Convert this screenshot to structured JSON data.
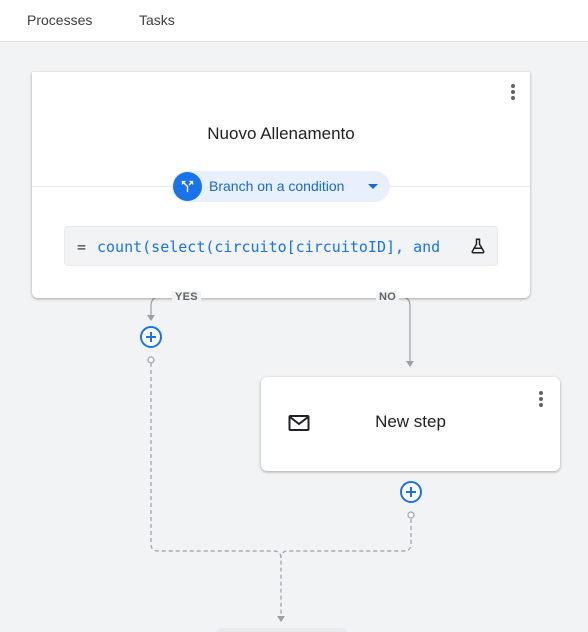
{
  "tabs": [
    {
      "label": "Processes"
    },
    {
      "label": "Tasks"
    }
  ],
  "branch_card": {
    "title": "Nuovo Allenamento",
    "chip_label": "Branch on a condition",
    "expression_prefix": "=",
    "expression": "count(select(circuito[circuitoID], and",
    "icons": [
      "more-vert-icon",
      "branch-icon",
      "dropdown-caret-icon",
      "flask-icon"
    ]
  },
  "branches": {
    "yes_label": "YES",
    "no_label": "NO"
  },
  "step_card": {
    "title": "New step",
    "icons": [
      "mail-icon",
      "more-vert-icon"
    ]
  },
  "colors": {
    "accent": "#1a73e8",
    "chip_bg": "#e8f0fe",
    "canvas_bg": "#f1f3f4",
    "connector": "#9aa0a6"
  }
}
